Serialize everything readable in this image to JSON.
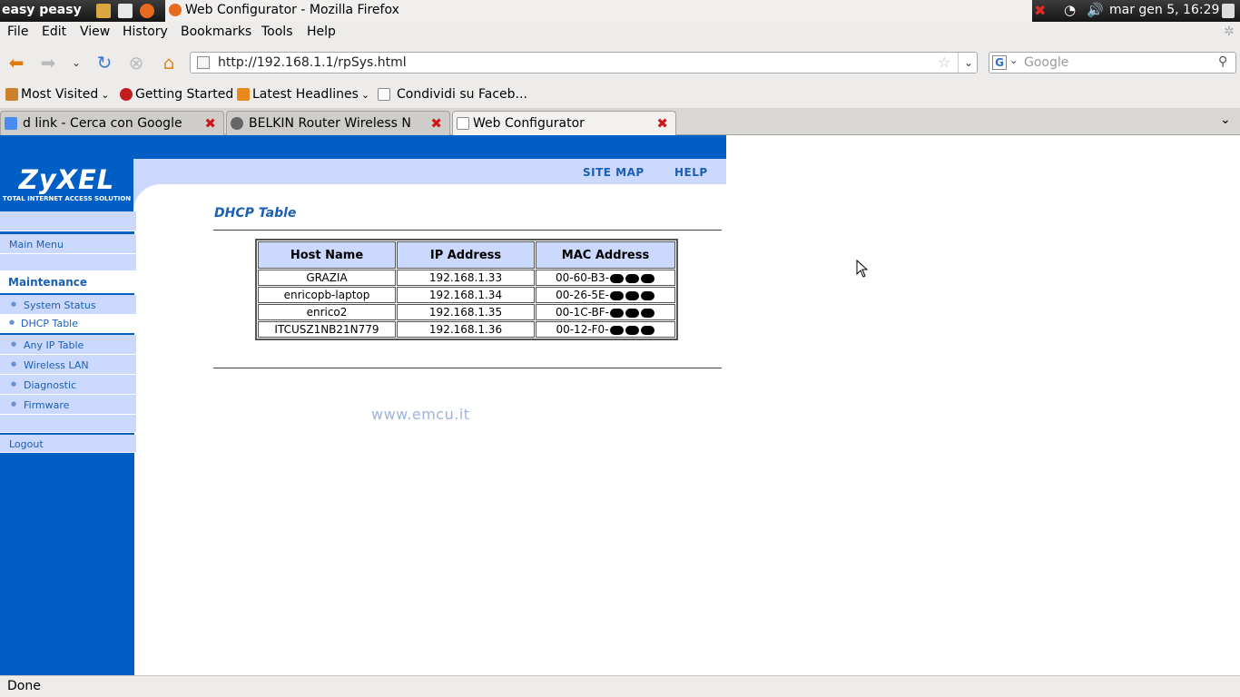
{
  "system_panel": {
    "distro_label": "easy peasy",
    "window_title": "Web Configurator - Mozilla Firefox",
    "clock": "mar gen  5, 16:29"
  },
  "menu": [
    "File",
    "Edit",
    "View",
    "History",
    "Bookmarks",
    "Tools",
    "Help"
  ],
  "navigation": {
    "url": "http://192.168.1.1/rpSys.html",
    "search_placeholder": "Google"
  },
  "bookmarks": [
    {
      "label": "Most Visited",
      "dropdown": true,
      "icon": "folder-icon",
      "color": "#c9812b"
    },
    {
      "label": "Getting Started",
      "dropdown": false,
      "icon": "firefox-icon",
      "color": "#c41c1c"
    },
    {
      "label": "Latest Headlines",
      "dropdown": true,
      "icon": "rss-icon",
      "color": "#e8891b"
    },
    {
      "label": "Condividi su Faceb...",
      "dropdown": false,
      "icon": "page-icon",
      "color": "#888888"
    }
  ],
  "tabs": [
    {
      "label": "d link - Cerca con Google",
      "active": false
    },
    {
      "label": "BELKIN Router Wireless N",
      "active": false
    },
    {
      "label": "Web Configurator",
      "active": true
    }
  ],
  "zyxel": {
    "logo": "ZyXEL",
    "logo_tagline": "TOTAL INTERNET ACCESS SOLUTION",
    "header_links": [
      "SITE MAP",
      "HELP"
    ],
    "sidebar": {
      "main_menu": "Main Menu",
      "section": "Maintenance",
      "items": [
        "System Status",
        "DHCP Table",
        "Any IP Table",
        "Wireless LAN",
        "Diagnostic",
        "Firmware"
      ],
      "selected": "DHCP Table",
      "logout": "Logout"
    },
    "page_title": "DHCP Table",
    "table": {
      "headers": [
        "Host Name",
        "IP Address",
        "MAC Address"
      ],
      "rows": [
        {
          "host": "GRAZIA",
          "ip": "192.168.1.33",
          "mac_prefix": "00-60-B3-"
        },
        {
          "host": "enricopb-laptop",
          "ip": "192.168.1.34",
          "mac_prefix": "00-26-5E-"
        },
        {
          "host": "enrico2",
          "ip": "192.168.1.35",
          "mac_prefix": "00-1C-BF-"
        },
        {
          "host": "ITCUSZ1NB21N779",
          "ip": "192.168.1.36",
          "mac_prefix": "00-12-F0-"
        }
      ]
    },
    "watermark": "www.emcu.it"
  },
  "status_bar": "Done",
  "colors": {
    "zyxel_blue": "#005ec5",
    "zyxel_light": "#ccd9ff",
    "link_blue": "#1a5fb4"
  }
}
